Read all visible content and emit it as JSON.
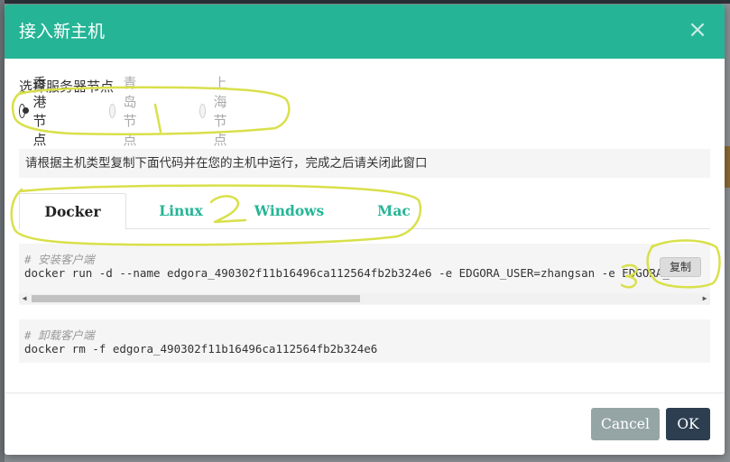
{
  "colors": {
    "accent": "#25b596",
    "header_bg": "#25b596",
    "ok_button": "#2c3e50",
    "cancel_button": "#95a5a6",
    "annotation": "#d9e04a"
  },
  "modal": {
    "title": "接入新主机",
    "close_icon": "close-icon"
  },
  "server_node": {
    "label": "选择服务器节点",
    "options": [
      {
        "label": "香港节点",
        "checked": true,
        "disabled": false
      },
      {
        "label": "青岛节点",
        "checked": false,
        "disabled": true
      },
      {
        "label": "上海节点",
        "checked": false,
        "disabled": true
      }
    ]
  },
  "notice": "请根据主机类型复制下面代码并在您的主机中运行，完成之后请关闭此窗口",
  "tabs": [
    {
      "label": "Docker",
      "active": true
    },
    {
      "label": "Linux",
      "active": false
    },
    {
      "label": "Windows",
      "active": false
    },
    {
      "label": "Mac",
      "active": false
    }
  ],
  "install_block": {
    "comment": "# 安装客户端",
    "code": "docker run -d --name edgora_490302f11b16496ca112564fb2b324e6 -e EDGORA_USER=zhangsan -e EDGORA_CL",
    "copy_label": "复制"
  },
  "uninstall_block": {
    "comment": "# 卸载客户端",
    "code": "docker rm -f edgora_490302f11b16496ca112564fb2b324e6"
  },
  "footer": {
    "cancel_label": "Cancel",
    "ok_label": "OK"
  },
  "annotations": [
    "1",
    "2",
    "3"
  ]
}
